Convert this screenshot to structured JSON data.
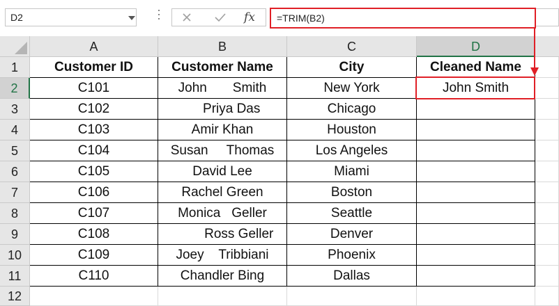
{
  "name_box": {
    "value": "D2"
  },
  "formula_bar": {
    "cancel_icon": "close-icon",
    "enter_icon": "check-icon",
    "fx_label": "fx",
    "formula": "=TRIM(B2)"
  },
  "columns": [
    "A",
    "B",
    "C",
    "D"
  ],
  "selected_column": "D",
  "rows": [
    "1",
    "2",
    "3",
    "4",
    "5",
    "6",
    "7",
    "8",
    "9",
    "10",
    "11",
    "12"
  ],
  "selected_row": "2",
  "table": {
    "headers": [
      "Customer ID",
      "Customer Name",
      "City",
      "Cleaned Name"
    ],
    "data": [
      [
        "C101",
        "John       Smith",
        "New York",
        "John Smith"
      ],
      [
        "C102",
        "     Priya Das",
        "Chicago",
        ""
      ],
      [
        "C103",
        "Amir Khan",
        "Houston",
        ""
      ],
      [
        "C104",
        "Susan     Thomas",
        "Los Angeles",
        ""
      ],
      [
        "C105",
        "David Lee",
        "Miami",
        ""
      ],
      [
        "C106",
        "Rachel Green",
        "Boston",
        ""
      ],
      [
        "C107",
        "Monica   Geller",
        "Seattle",
        ""
      ],
      [
        "C108",
        "         Ross Geller",
        "Denver",
        ""
      ],
      [
        "C109",
        "Joey    Tribbiani",
        "Phoenix",
        ""
      ],
      [
        "C110",
        "Chandler Bing",
        "Dallas",
        ""
      ]
    ]
  },
  "colors": {
    "highlight": "#e01f26",
    "excel_green": "#217346"
  }
}
